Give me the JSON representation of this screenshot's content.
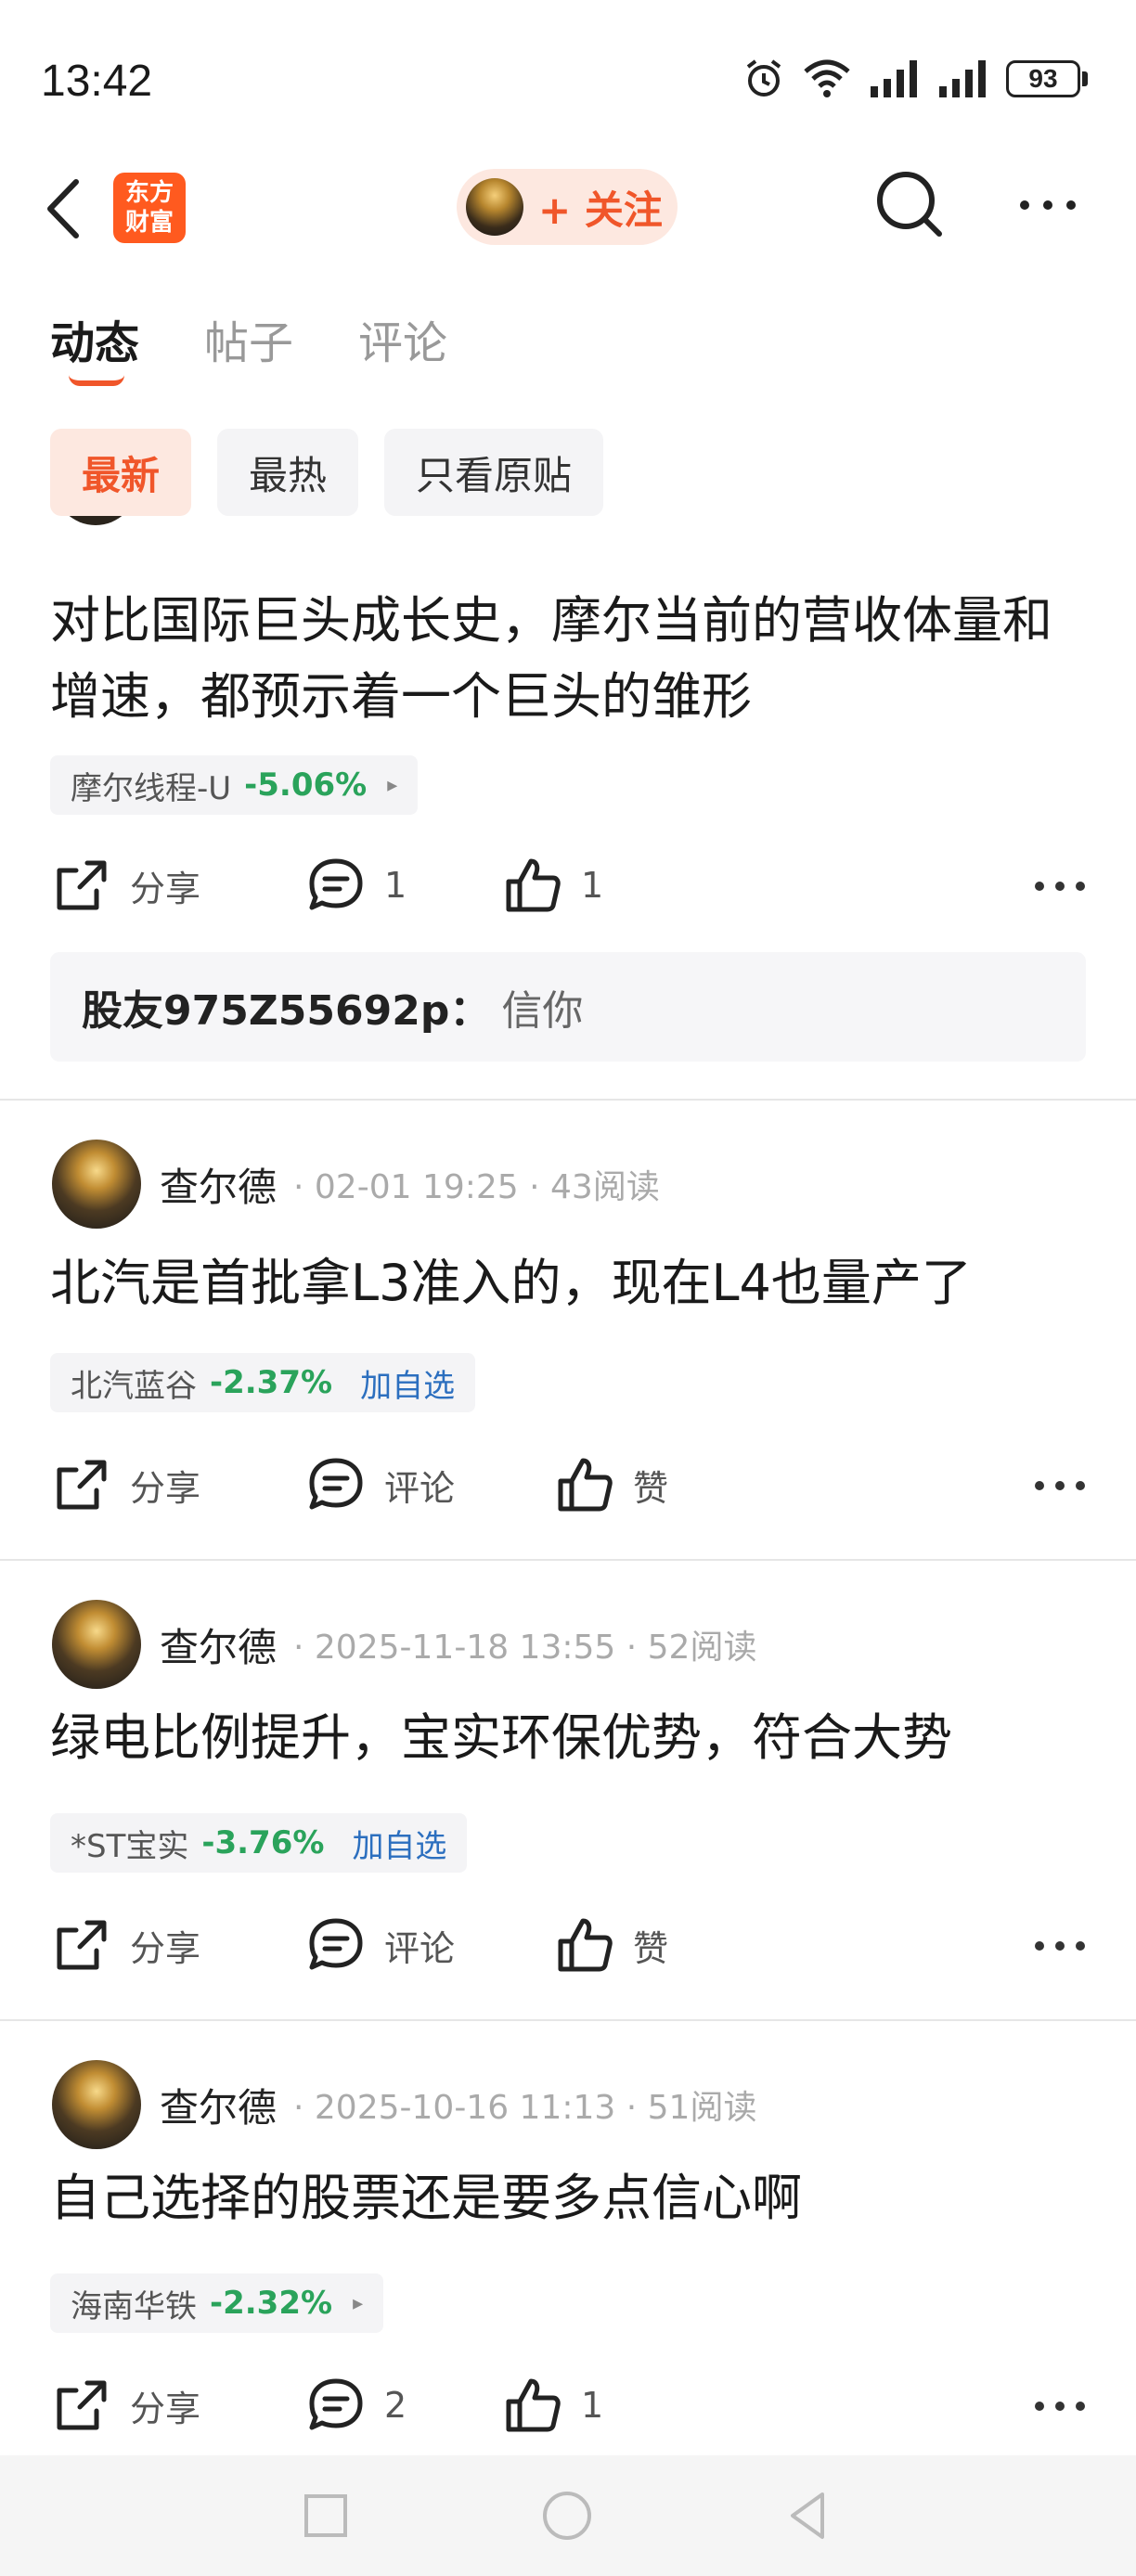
{
  "status": {
    "time": "13:42",
    "battery": "93"
  },
  "header": {
    "logo_line1": "东方",
    "logo_line2": "财富",
    "follow_label": "+ 关注"
  },
  "tabs": [
    {
      "label": "动态",
      "active": true
    },
    {
      "label": "帖子",
      "active": false
    },
    {
      "label": "评论",
      "active": false
    }
  ],
  "filters": [
    {
      "label": "最新",
      "active": true
    },
    {
      "label": "最热",
      "active": false
    },
    {
      "label": "只看原贴",
      "active": false
    }
  ],
  "colors": {
    "accent": "#f0562a",
    "down": "#2aa35b",
    "link": "#2c6fbf"
  },
  "posts": [
    {
      "text": "对比国际巨头成长史，摩尔当前的营收体量和增速，都预示着一个巨头的雏形",
      "stock_name": "摩尔线程-U",
      "stock_change": "-5.06%",
      "stock_arrow": "▸",
      "share_label": "分享",
      "comment_label": "1",
      "like_label": "1",
      "reply_user": "股友975Z55692p：",
      "reply_text": "信你"
    },
    {
      "author": "查尔德",
      "meta": "· 02-01 19:25 · 43阅读",
      "text": "北汽是首批拿L3准入的，现在L4也量产了",
      "stock_name": "北汽蓝谷",
      "stock_change": "-2.37%",
      "stock_add": "加自选",
      "share_label": "分享",
      "comment_label": "评论",
      "like_label": "赞"
    },
    {
      "author": "查尔德",
      "meta": "· 2025-11-18 13:55 · 52阅读",
      "text": "绿电比例提升，宝实环保优势，符合大势",
      "stock_name": "*ST宝实",
      "stock_change": "-3.76%",
      "stock_add": "加自选",
      "share_label": "分享",
      "comment_label": "评论",
      "like_label": "赞"
    },
    {
      "author": "查尔德",
      "meta": "· 2025-10-16 11:13 · 51阅读",
      "text": "自己选择的股票还是要多点信心啊",
      "stock_name": "海南华铁",
      "stock_change": "-2.32%",
      "stock_arrow": "▸",
      "share_label": "分享",
      "comment_label": "2",
      "like_label": "1"
    }
  ]
}
